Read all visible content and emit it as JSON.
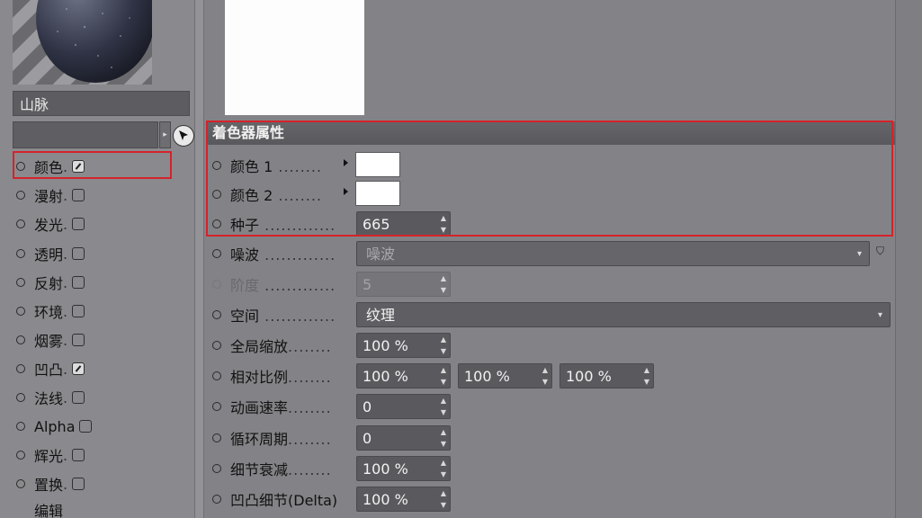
{
  "material": {
    "name": "山脉"
  },
  "channels": [
    {
      "label": "颜色",
      "checked": true
    },
    {
      "label": "漫射",
      "checked": false
    },
    {
      "label": "发光",
      "checked": false
    },
    {
      "label": "透明",
      "checked": false
    },
    {
      "label": "反射",
      "checked": false
    },
    {
      "label": "环境",
      "checked": false
    },
    {
      "label": "烟雾",
      "checked": false
    },
    {
      "label": "凹凸",
      "checked": true
    },
    {
      "label": "法线",
      "checked": false
    },
    {
      "label": "Alpha",
      "checked": false
    },
    {
      "label": "辉光",
      "checked": false
    },
    {
      "label": "置换",
      "checked": false
    },
    {
      "label": "编辑",
      "checked": null
    }
  ],
  "shader": {
    "section_title": "着色器属性",
    "color1_label": "颜色 1",
    "color2_label": "颜色 2",
    "seed_label": "种子",
    "seed_value": "665",
    "noise_label": "噪波",
    "noise_value": "噪波",
    "octave_label": "阶度",
    "octave_value": "5",
    "space_label": "空间",
    "space_value": "纹理",
    "global_scale_label": "全局缩放",
    "global_scale_value": "100 %",
    "relative_scale_label": "相对比例",
    "relative_scale_x": "100 %",
    "relative_scale_y": "100 %",
    "relative_scale_z": "100 %",
    "anim_speed_label": "动画速率",
    "anim_speed_value": "0",
    "loop_period_label": "循环周期",
    "loop_period_value": "0",
    "detail_attenuation_label": "细节衰减",
    "detail_attenuation_value": "100 %",
    "bump_detail_label": "凹凸细节(Delta)",
    "bump_detail_value": "100 %"
  },
  "icons": {
    "picker": "arrow-pointer-icon",
    "spinner": "up-down-arrows-icon",
    "dropdown": "chevron-down-icon"
  },
  "colors": {
    "highlight": "#d4232b",
    "color1": "#ffffff",
    "color2": "#ffffff"
  }
}
